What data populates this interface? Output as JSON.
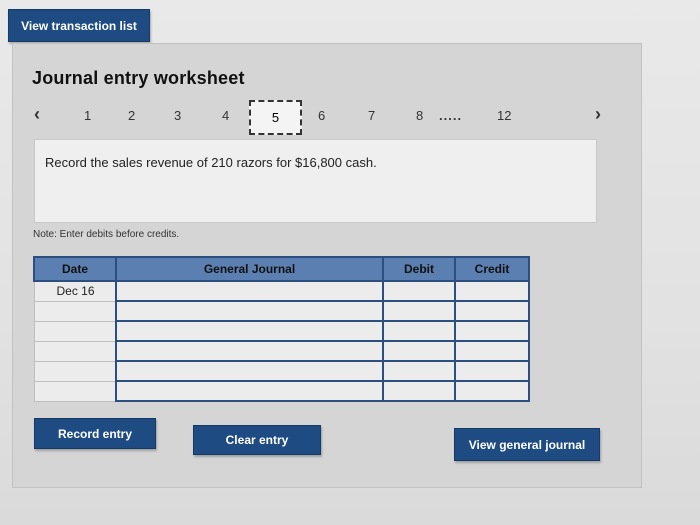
{
  "top": {
    "view_transactions_label": "View transaction list"
  },
  "worksheet": {
    "title": "Journal entry worksheet",
    "nav": {
      "prev_icon": "chevron-left-icon",
      "next_icon": "chevron-right-icon",
      "steps": [
        "1",
        "2",
        "3",
        "4",
        "5",
        "6",
        "7",
        "8",
        "12"
      ],
      "ellipsis": ".....",
      "current": "5"
    },
    "instruction": "Record the sales revenue of 210 razors for $16,800 cash.",
    "note": "Note: Enter debits before credits."
  },
  "journal": {
    "headers": {
      "date": "Date",
      "general_journal": "General Journal",
      "debit": "Debit",
      "credit": "Credit"
    },
    "rows": [
      {
        "date": "Dec 16",
        "account": "",
        "debit": "",
        "credit": ""
      },
      {
        "date": "",
        "account": "",
        "debit": "",
        "credit": ""
      },
      {
        "date": "",
        "account": "",
        "debit": "",
        "credit": ""
      },
      {
        "date": "",
        "account": "",
        "debit": "",
        "credit": ""
      },
      {
        "date": "",
        "account": "",
        "debit": "",
        "credit": ""
      },
      {
        "date": "",
        "account": "",
        "debit": "",
        "credit": ""
      }
    ]
  },
  "actions": {
    "record_label": "Record entry",
    "clear_label": "Clear entry",
    "view_general_label": "View general journal"
  },
  "colors": {
    "button": "#1f4b83",
    "header": "#5b7fb0",
    "border": "#2d4f80"
  }
}
